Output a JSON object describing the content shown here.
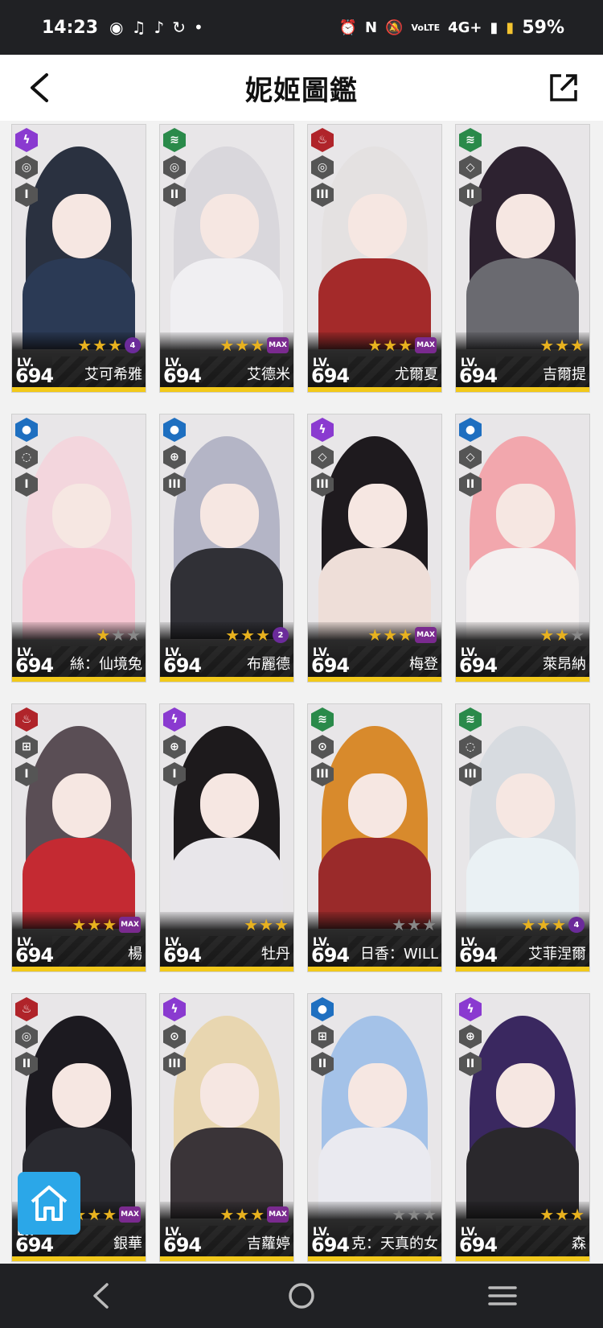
{
  "status": {
    "time": "14:23",
    "battery": "59%",
    "network": "4G+",
    "volte": "VoLTE"
  },
  "header": {
    "title": "妮姬圖鑑"
  },
  "colors": {
    "electric": "#8a3ad0",
    "wind": "#2a8a4a",
    "fire": "#b0242a",
    "water": "#1e6fc0"
  },
  "cards": [
    {
      "name": "艾可希雅",
      "lv_label": "LV.",
      "level": "694",
      "element": "electric",
      "weapon": "◎",
      "burst": "I",
      "stars": 3,
      "badge": "4",
      "hair": "#2a3140",
      "body": "#2b3a55"
    },
    {
      "name": "艾德米",
      "lv_label": "LV.",
      "level": "694",
      "element": "wind",
      "weapon": "◎",
      "burst": "II",
      "stars": 3,
      "badge": "MAX",
      "hair": "#d9d7dc",
      "body": "#f0eff2"
    },
    {
      "name": "尤爾夏",
      "lv_label": "LV.",
      "level": "694",
      "element": "fire",
      "weapon": "◎",
      "burst": "III",
      "stars": 3,
      "badge": "MAX",
      "hair": "#e4e1e1",
      "body": "#a42a2a"
    },
    {
      "name": "吉爾提",
      "lv_label": "LV.",
      "level": "694",
      "element": "wind",
      "weapon": "◇",
      "burst": "II",
      "stars": 3,
      "badge": "",
      "hair": "#2d2230",
      "body": "#6a6a70"
    },
    {
      "name": "絲：仙境兔",
      "lv_label": "LV.",
      "level": "694",
      "element": "water",
      "weapon": "◌",
      "burst": "I",
      "stars": 1,
      "badge": "",
      "hair": "#f3d6dd",
      "body": "#f6c6d2"
    },
    {
      "name": "布麗德",
      "lv_label": "LV.",
      "level": "694",
      "element": "water",
      "weapon": "⊕",
      "burst": "III",
      "stars": 3,
      "badge": "2",
      "hair": "#b4b5c6",
      "body": "#303036"
    },
    {
      "name": "梅登",
      "lv_label": "LV.",
      "level": "694",
      "element": "electric",
      "weapon": "◇",
      "burst": "III",
      "stars": 3,
      "badge": "MAX",
      "hair": "#1e1a1e",
      "body": "#eeded8"
    },
    {
      "name": "萊昂納",
      "lv_label": "LV.",
      "level": "694",
      "element": "water",
      "weapon": "◇",
      "burst": "II",
      "stars": 2,
      "badge": "",
      "hair": "#f2a7ad",
      "body": "#f4f0f0"
    },
    {
      "name": "楊",
      "lv_label": "LV.",
      "level": "694",
      "element": "fire",
      "weapon": "⊞",
      "burst": "I",
      "stars": 3,
      "badge": "MAX",
      "hair": "#5a4e55",
      "body": "#c42a32"
    },
    {
      "name": "牡丹",
      "lv_label": "LV.",
      "level": "694",
      "element": "electric",
      "weapon": "⊕",
      "burst": "I",
      "stars": 3,
      "badge": "",
      "hair": "#1d1a1c",
      "body": "#e8e6ea"
    },
    {
      "name": "日香：WILL",
      "lv_label": "LV.",
      "level": "694",
      "element": "wind",
      "weapon": "⊙",
      "burst": "III",
      "stars": 0,
      "badge": "",
      "hair": "#d88a2c",
      "body": "#9a2a2a"
    },
    {
      "name": "艾菲涅爾",
      "lv_label": "LV.",
      "level": "694",
      "element": "wind",
      "weapon": "◌",
      "burst": "III",
      "stars": 3,
      "badge": "4",
      "hair": "#d7dbe0",
      "body": "#eaf1f4"
    },
    {
      "name": "銀華",
      "lv_label": "LV.",
      "level": "694",
      "element": "fire",
      "weapon": "◎",
      "burst": "II",
      "stars": 3,
      "badge": "MAX",
      "hair": "#1c1a20",
      "body": "#2a2a30"
    },
    {
      "name": "吉蘿婷",
      "lv_label": "LV.",
      "level": "694",
      "element": "electric",
      "weapon": "⊙",
      "burst": "III",
      "stars": 3,
      "badge": "MAX",
      "hair": "#e8d6b0",
      "body": "#3a3438"
    },
    {
      "name": "克：天真的女",
      "lv_label": "LV.",
      "level": "694",
      "element": "water",
      "weapon": "⊞",
      "burst": "II",
      "stars": 0,
      "badge": "",
      "hair": "#a4c2e8",
      "body": "#eaeaf0"
    },
    {
      "name": "森",
      "lv_label": "LV.",
      "level": "694",
      "element": "electric",
      "weapon": "⊕",
      "burst": "II",
      "stars": 3,
      "badge": "",
      "hair": "#3a2860",
      "body": "#2a282c"
    }
  ],
  "icons": {
    "back": "chevron-left-icon",
    "share": "external-link-icon",
    "home": "home-icon",
    "nav_back": "nav-back-icon",
    "nav_home": "nav-home-icon",
    "nav_recents": "nav-recents-icon"
  }
}
